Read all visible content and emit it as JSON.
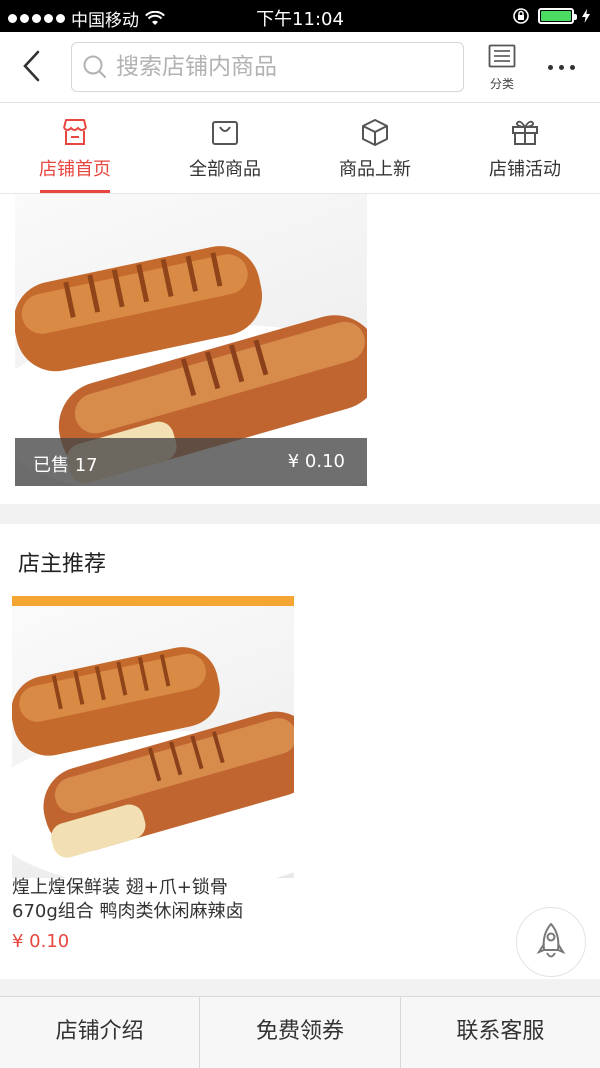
{
  "status_bar": {
    "carrier": "中国移动",
    "time": "下午11:04"
  },
  "header": {
    "search_placeholder": "搜索店铺内商品",
    "category_label": "分类"
  },
  "tabs": [
    {
      "label": "店铺首页",
      "icon": "shop-icon",
      "active": true
    },
    {
      "label": "全部商品",
      "icon": "bag-icon",
      "active": false
    },
    {
      "label": "商品上新",
      "icon": "box-icon",
      "active": false
    },
    {
      "label": "店铺活动",
      "icon": "gift-icon",
      "active": false
    }
  ],
  "featured": {
    "sold": "已售 17",
    "price": "¥ 0.10"
  },
  "recommend": {
    "title": "店主推荐",
    "product_name_line1": "煌上煌保鲜装 翅+爪+锁骨",
    "product_name_line2": "670g组合 鸭肉类休闲麻辣卤",
    "price": "¥ 0.10"
  },
  "footer": {
    "intro": "店铺介绍",
    "coupon": "免费领券",
    "service": "联系客服"
  },
  "colors": {
    "accent": "#e8473f"
  }
}
